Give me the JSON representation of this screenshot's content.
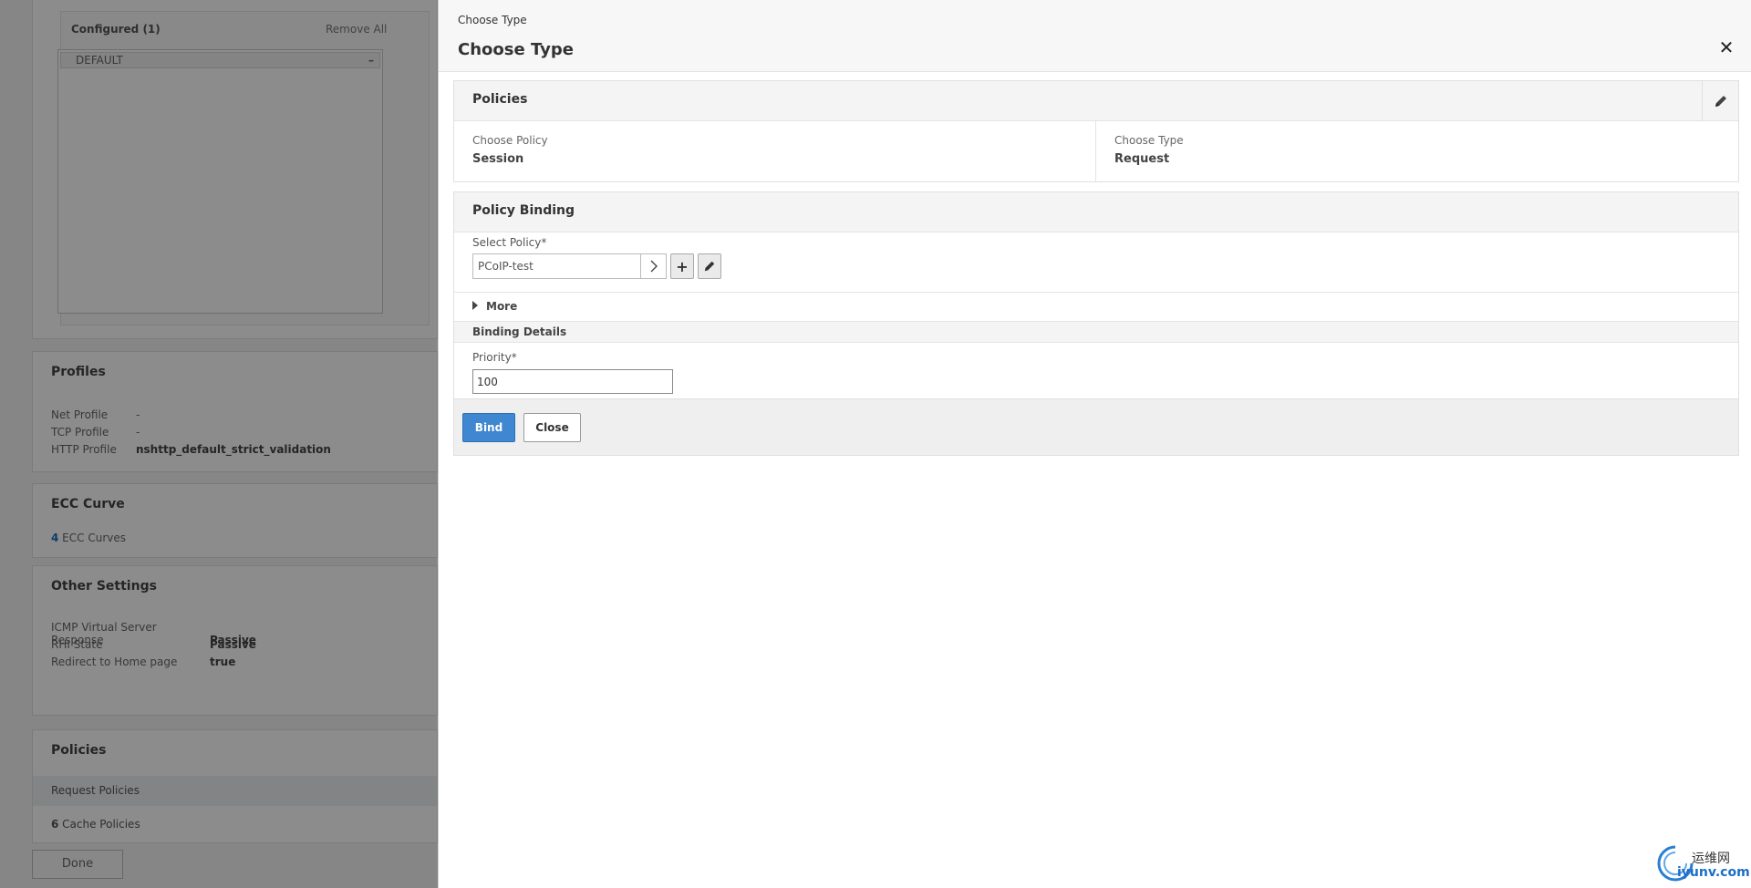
{
  "background": {
    "configured": {
      "header": "Configured (1)",
      "remove_all": "Remove All",
      "items": [
        "DEFAULT"
      ],
      "minus": "–"
    },
    "profiles": {
      "title": "Profiles",
      "rows": [
        {
          "key": "Net Profile",
          "value": "-"
        },
        {
          "key": "TCP Profile",
          "value": "-"
        },
        {
          "key": "HTTP Profile",
          "value": "nshttp_default_strict_validation"
        }
      ]
    },
    "ecc": {
      "title": "ECC Curve",
      "count": "4",
      "label": " ECC Curves"
    },
    "other_settings": {
      "title": "Other Settings",
      "rows": [
        {
          "key": "ICMP Virtual Server Response",
          "value": "Passive"
        },
        {
          "key": "RHI State",
          "value": "Passive"
        },
        {
          "key": "Redirect to Home page",
          "value": "true"
        }
      ]
    },
    "policies": {
      "title": "Policies",
      "request_row": "Request Policies",
      "cache_count": "6",
      "cache_label": " Cache Policies"
    },
    "done_label": "Done"
  },
  "panel": {
    "breadcrumb": "Choose Type",
    "title": "Choose Type",
    "close_glyph": "✕",
    "policies_section": {
      "title": "Policies",
      "choose_policy_label": "Choose Policy",
      "choose_policy_value": "Session",
      "choose_type_label": "Choose Type",
      "choose_type_value": "Request"
    },
    "binding_section": {
      "title": "Policy Binding",
      "select_policy_label": "Select Policy*",
      "select_policy_value": "PCoIP-test",
      "plus_glyph": "+",
      "more_label": "More",
      "binding_details_title": "Binding Details",
      "priority_label": "Priority*",
      "priority_value": "100"
    },
    "buttons": {
      "bind": "Bind",
      "close": "Close"
    },
    "colors": {
      "primary": "#3f87d0",
      "overlay": "rgba(0,0,0,0.45)"
    }
  },
  "watermark": {
    "cn": "运维网",
    "en": "iyunv.com"
  }
}
